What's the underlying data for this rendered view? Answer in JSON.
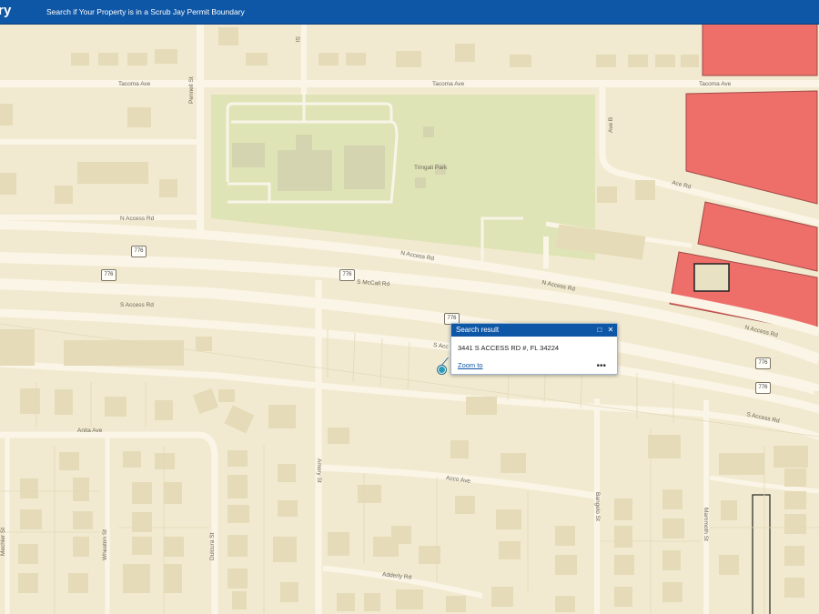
{
  "header": {
    "brand": "ry",
    "title": "Search if Your Property is in a Scrub Jay Permit Boundary"
  },
  "colors": {
    "map_bg": "#f2ead0",
    "road": "#faf5e6",
    "park": "#dfe4b6",
    "boundary": "#ee6e6a",
    "header": "#0e56a6"
  },
  "map": {
    "park_label": "Tringali Park",
    "streets": {
      "tacoma_1": "Tacoma Ave",
      "tacoma_2": "Tacoma Ave",
      "pennell": "Pennell St",
      "top_st": "St",
      "ave_b": "Ave B",
      "ace_rd": "Ace Rd",
      "n_access_1": "N Access Rd",
      "n_access_2": "N Access Rd",
      "n_access_3": "N Access Rd",
      "n_access_4": "N Access Rd",
      "s_mccall": "S McCall Rd",
      "s_access_1": "S Access Rd",
      "s_access_2": "S Acc",
      "s_access_3": "S Access Rd",
      "anita": "Anita Ave",
      "acco": "Acco Ave",
      "adderly": "Adderly Rd",
      "amory": "Amory St",
      "bangelo": "Bangelo St",
      "mammoth": "Mammoth St",
      "mechler": "Mechler St",
      "wheaton": "Wheaton St",
      "dulcura": "Dulcura St"
    },
    "shields": [
      "776",
      "776",
      "776",
      "776",
      "776",
      "776"
    ]
  },
  "popup": {
    "title": "Search result",
    "address": "3441 S ACCESS RD #, FL 34224",
    "zoom_label": "Zoom to",
    "more_label": "•••",
    "maximize_icon": "□",
    "close_icon": "✕"
  }
}
